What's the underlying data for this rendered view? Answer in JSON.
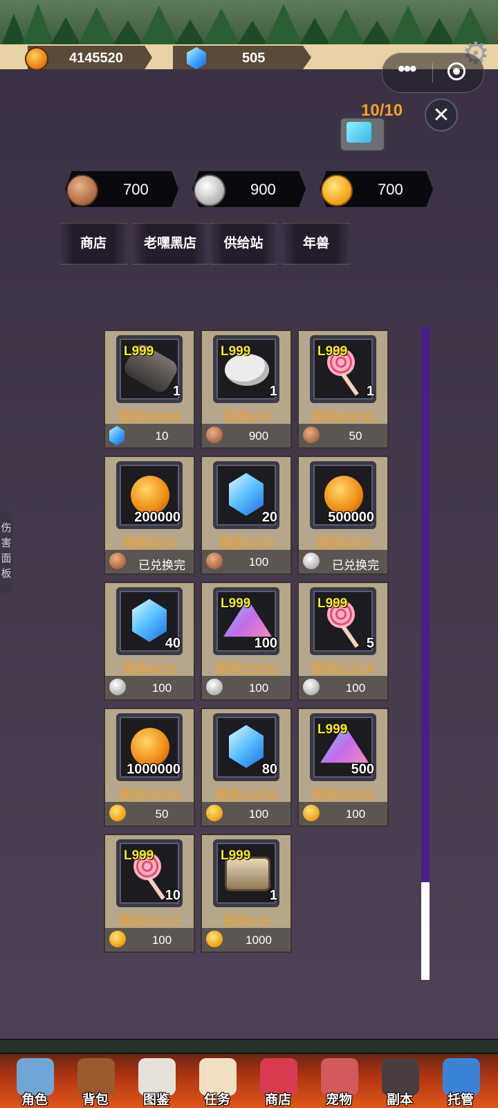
{
  "resources": [
    {
      "icon": "gold-coin-icon",
      "value": "4145520"
    },
    {
      "icon": "diamond-icon",
      "value": "505"
    }
  ],
  "video_reward": {
    "count": "10/10"
  },
  "currencies": [
    {
      "icon": "bronze-medal-icon",
      "value": "700"
    },
    {
      "icon": "silver-medal-icon",
      "value": "900"
    },
    {
      "icon": "gold-medal-icon",
      "value": "700"
    }
  ],
  "tabs": [
    "商店",
    "老嘿黑店",
    "供给站",
    "年兽"
  ],
  "items": [
    {
      "art": "bomb",
      "level": "L999",
      "qty": "1",
      "limit": "限购39/99",
      "price_icon": "gem",
      "price": "10"
    },
    {
      "art": "egg",
      "level": "L999",
      "qty": "1",
      "limit": "限购2/4",
      "price_icon": "bronze",
      "price": "900"
    },
    {
      "art": "candy",
      "level": "L999",
      "qty": "1",
      "limit": "限购24/30",
      "price_icon": "bronze",
      "price": "50"
    },
    {
      "art": "coins",
      "level": "",
      "qty": "200000",
      "limit": "限购0/20",
      "price_icon": "bronze",
      "price": "已兑换完"
    },
    {
      "art": "gem",
      "level": "",
      "qty": "20",
      "limit": "限购3/10",
      "price_icon": "bronze",
      "price": "100"
    },
    {
      "art": "coins",
      "level": "",
      "qty": "500000",
      "limit": "限购0/20",
      "price_icon": "silver",
      "price": "已兑换完"
    },
    {
      "art": "gem",
      "level": "",
      "qty": "40",
      "limit": "限购4/10",
      "price_icon": "silver",
      "price": "100"
    },
    {
      "art": "pyramid",
      "level": "L999",
      "qty": "100",
      "limit": "限购20/20",
      "price_icon": "silver",
      "price": "100"
    },
    {
      "art": "candy",
      "level": "L999",
      "qty": "5",
      "limit": "限购13/24",
      "price_icon": "silver",
      "price": "100"
    },
    {
      "art": "coins",
      "level": "",
      "qty": "1000000",
      "limit": "限购20/20",
      "price_icon": "gold",
      "price": "50"
    },
    {
      "art": "gem",
      "level": "",
      "qty": "80",
      "limit": "限购10/10",
      "price_icon": "gold",
      "price": "100"
    },
    {
      "art": "pyramid",
      "level": "L999",
      "qty": "500",
      "limit": "限购20/20",
      "price_icon": "gold",
      "price": "100"
    },
    {
      "art": "candy",
      "level": "L999",
      "qty": "10",
      "limit": "限购12/12",
      "price_icon": "gold",
      "price": "100"
    },
    {
      "art": "chest",
      "level": "L999",
      "qty": "1",
      "limit": "限购1/5",
      "price_icon": "gold",
      "price": "1000"
    }
  ],
  "scroll": {
    "position": 0.85
  },
  "side_panel": {
    "label": "伤害面板"
  },
  "nav": [
    {
      "label": "角色",
      "icon": "helmet-icon",
      "color": "#6fa6d6"
    },
    {
      "label": "背包",
      "icon": "backpack-icon",
      "color": "#9a5a2e"
    },
    {
      "label": "图鉴",
      "icon": "book-icon",
      "color": "#e6e2da"
    },
    {
      "label": "任务",
      "icon": "scroll-icon",
      "color": "#f2e0c2"
    },
    {
      "label": "商店",
      "icon": "shop-icon",
      "color": "#d83a4f"
    },
    {
      "label": "宠物",
      "icon": "meat-icon",
      "color": "#d35a5a"
    },
    {
      "label": "副本",
      "icon": "skull-gate-icon",
      "color": "#4a3d42"
    },
    {
      "label": "托管",
      "icon": "calendar-icon",
      "color": "#3a84d8"
    }
  ],
  "colors": {
    "limit_text": "#f0a02a",
    "level_text": "#f6ef1a",
    "scroll_thumb": "#4a1f87"
  }
}
